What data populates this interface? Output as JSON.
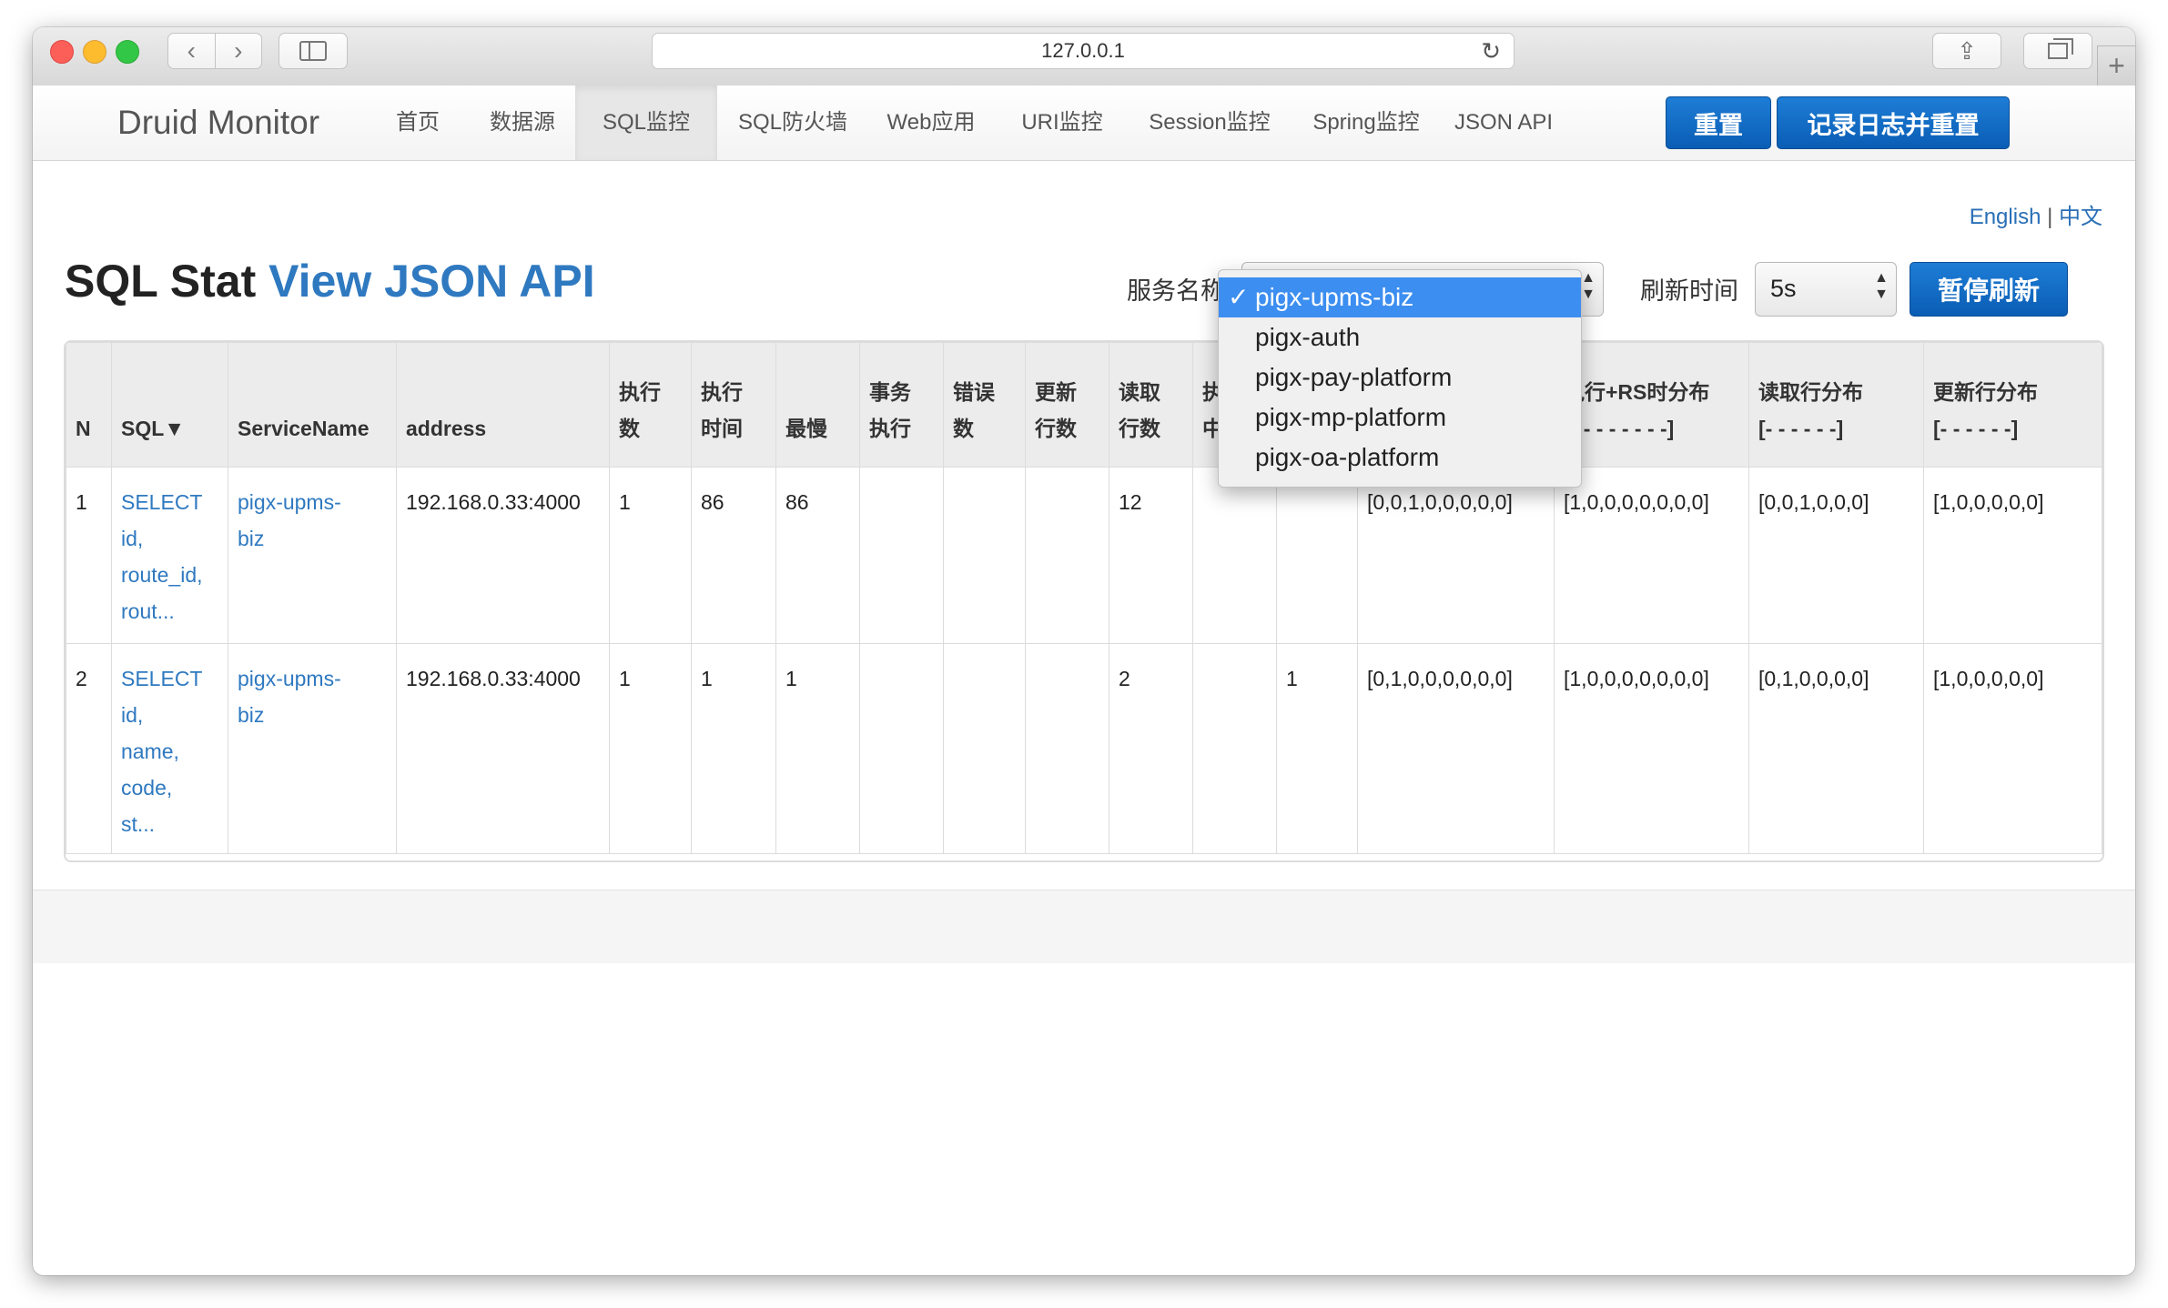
{
  "browser": {
    "url": "127.0.0.1",
    "back_glyph": "‹",
    "forward_glyph": "›",
    "reload_glyph": "↻",
    "share_glyph": "⇪",
    "newtab_glyph": "+"
  },
  "navbar": {
    "brand": "Druid Monitor",
    "items": [
      "首页",
      "数据源",
      "SQL监控",
      "SQL防火墙",
      "Web应用",
      "URI监控",
      "Session监控",
      "Spring监控",
      "JSON API"
    ],
    "active_index": 2,
    "reset_button": "重置",
    "log_reset_button": "记录日志并重置"
  },
  "lang": {
    "english": "English",
    "sep": "|",
    "chinese": "中文"
  },
  "page": {
    "title": "SQL Stat",
    "title_link": "View JSON API"
  },
  "controls": {
    "service_label": "服务名称",
    "refresh_label": "刷新时间",
    "refresh_value": "5s",
    "pause_button": "暂停刷新"
  },
  "dropdown": {
    "options": [
      "pigx-upms-biz",
      "pigx-auth",
      "pigx-pay-platform",
      "pigx-mp-platform",
      "pigx-oa-platform"
    ],
    "selected_index": 0,
    "check": "✓"
  },
  "table": {
    "headers": [
      [
        "N"
      ],
      [
        "SQL▼"
      ],
      [
        "ServiceName"
      ],
      [
        "address"
      ],
      [
        "执行",
        "数"
      ],
      [
        "执行",
        "时间"
      ],
      [
        "最慢"
      ],
      [
        "事务",
        "执行"
      ],
      [
        "错误",
        "数"
      ],
      [
        "更新",
        "行数"
      ],
      [
        "读取",
        "行数"
      ],
      [
        "执",
        "中"
      ],
      [
        "",
        ""
      ],
      [
        "",
        ""
      ],
      [
        "执行+RS时分布",
        "[- - - - - - - -]"
      ],
      [
        "读取行分布",
        "[- - - - - -]"
      ],
      [
        "更新行分布",
        "[- - - - - -]"
      ]
    ],
    "rows": [
      {
        "n": "1",
        "sql": [
          "SELECT",
          "id,",
          "route_id,",
          "rout..."
        ],
        "service": [
          "pigx-upms-",
          "biz"
        ],
        "address": "192.168.0.33:4000",
        "exec_count": "1",
        "exec_time": "86",
        "slowest": "86",
        "tx": "",
        "errors": "",
        "update_rows": "",
        "read_rows": "12",
        "running": "",
        "concurrent": "",
        "exec_dist": "[0,0,1,0,0,0,0,0]",
        "exec_rs_dist": "[1,0,0,0,0,0,0,0]",
        "read_dist": "[0,0,1,0,0,0]",
        "update_dist": "[1,0,0,0,0,0]"
      },
      {
        "n": "2",
        "sql": [
          "SELECT",
          "id,",
          "name,",
          "code,",
          "st..."
        ],
        "service": [
          "pigx-upms-",
          "biz"
        ],
        "address": "192.168.0.33:4000",
        "exec_count": "1",
        "exec_time": "1",
        "slowest": "1",
        "tx": "",
        "errors": "",
        "update_rows": "",
        "read_rows": "2",
        "running": "",
        "concurrent": "1",
        "exec_dist": "[0,1,0,0,0,0,0,0]",
        "exec_rs_dist": "[1,0,0,0,0,0,0,0]",
        "read_dist": "[0,1,0,0,0,0]",
        "update_dist": "[1,0,0,0,0,0]"
      }
    ]
  }
}
